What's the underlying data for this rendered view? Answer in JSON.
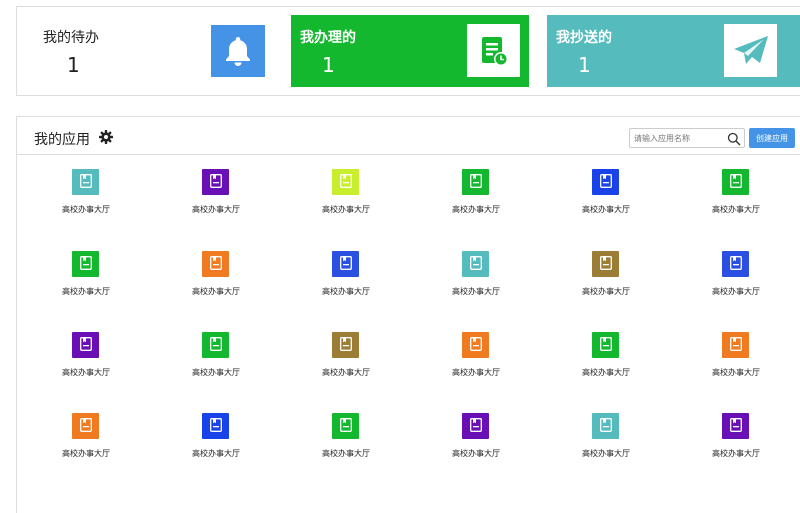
{
  "stats": {
    "todo": {
      "title": "我的待办",
      "count": "1",
      "icon": "bell-icon"
    },
    "handled": {
      "title": "我办理的",
      "count": "1",
      "icon": "document-clock-icon"
    },
    "cc": {
      "title": "我抄送的",
      "count": "1",
      "icon": "paper-plane-icon"
    }
  },
  "colors": {
    "accent": "#4593e6",
    "green": "#14b82f",
    "teal": "#55bbbd"
  },
  "apps_panel": {
    "title": "我的应用",
    "settings_icon": "gear-icon",
    "search_placeholder": "请输入应用名称",
    "create_label": "创建应用"
  },
  "apps": [
    {
      "label": "高校办事大厅",
      "color": "#55bbbd"
    },
    {
      "label": "高校办事大厅",
      "color": "#6a0fb5"
    },
    {
      "label": "高校办事大厅",
      "color": "#c8ee2e"
    },
    {
      "label": "高校办事大厅",
      "color": "#14b82f"
    },
    {
      "label": "高校办事大厅",
      "color": "#1942e8"
    },
    {
      "label": "高校办事大厅",
      "color": "#14b82f"
    },
    {
      "label": "高校办事大厅",
      "color": "#14b82f"
    },
    {
      "label": "高校办事大厅",
      "color": "#f07a1f"
    },
    {
      "label": "高校办事大厅",
      "color": "#2b4fe0"
    },
    {
      "label": "高校办事大厅",
      "color": "#55bbbd"
    },
    {
      "label": "高校办事大厅",
      "color": "#9c7d36"
    },
    {
      "label": "高校办事大厅",
      "color": "#2b4fe0"
    },
    {
      "label": "高校办事大厅",
      "color": "#6a0fb5"
    },
    {
      "label": "高校办事大厅",
      "color": "#14b82f"
    },
    {
      "label": "高校办事大厅",
      "color": "#9c7d36"
    },
    {
      "label": "高校办事大厅",
      "color": "#f07a1f"
    },
    {
      "label": "高校办事大厅",
      "color": "#14b82f"
    },
    {
      "label": "高校办事大厅",
      "color": "#f07a1f"
    },
    {
      "label": "高校办事大厅",
      "color": "#f07a1f"
    },
    {
      "label": "高校办事大厅",
      "color": "#1942e8"
    },
    {
      "label": "高校办事大厅",
      "color": "#14b82f"
    },
    {
      "label": "高校办事大厅",
      "color": "#6a0fb5"
    },
    {
      "label": "高校办事大厅",
      "color": "#55bbbd"
    },
    {
      "label": "高校办事大厅",
      "color": "#6a0fb5"
    }
  ]
}
